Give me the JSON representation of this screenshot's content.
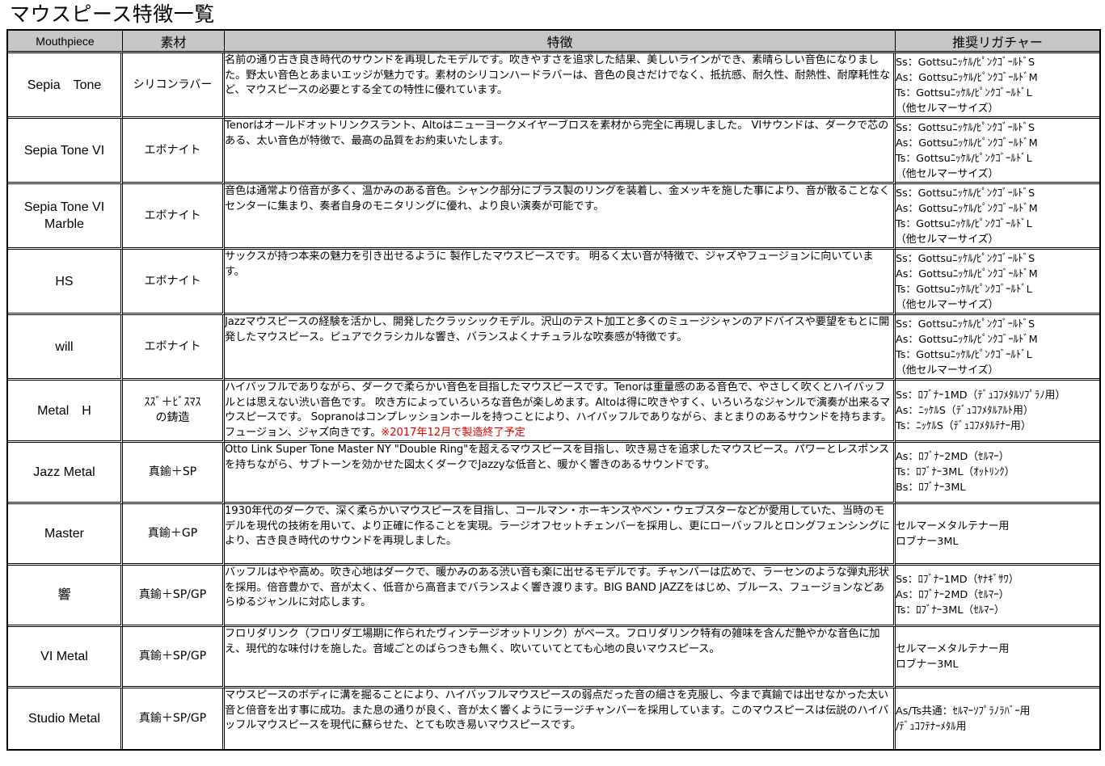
{
  "title": "マウスピース特徴一覧",
  "headers": {
    "name": "Mouthpiece",
    "material": "素材",
    "features": "特徴",
    "ligature": "推奨リガチャー"
  },
  "rows": [
    {
      "name": "Sepia　Tone",
      "material": "シリコンラバー",
      "features": "名前の通り古き良き時代のサウンドを再現したモデルです。吹きやすさを追求した結果、美しいラインができ、素晴らしい音色になりました。野太い音色とあまいエッジが魅力です。素材のシリコンハードラバーは、音色の良さだけでなく、抵抗感、耐久性、耐熱性、耐摩耗性など、マウスピースの必要とする全ての特性に優れています。",
      "ligature": [
        "Ss：Gottsuﾆｯｹﾙ/ﾋﾟﾝｸｺﾞｰﾙﾄﾞS",
        "As：Gottsuﾆｯｹﾙ/ﾋﾟﾝｸｺﾞｰﾙﾄﾞM",
        "Ts：Gottsuﾆｯｹﾙ/ﾋﾟﾝｸｺﾞｰﾙﾄﾞL",
        "（他セルマーサイズ）"
      ]
    },
    {
      "name": "Sepia Tone VI",
      "material": "エボナイト",
      "features": "Tenorはオールドオットリンクスラント、Altoはニューヨークメイヤーブロスを素材から完全に再現しました。 VIサウンドは、ダークで芯のある、太い音色が特徴で、最高の品質をお約束いたします。",
      "ligature": [
        "Ss：Gottsuﾆｯｹﾙ/ﾋﾟﾝｸｺﾞｰﾙﾄﾞS",
        "As：Gottsuﾆｯｹﾙ/ﾋﾟﾝｸｺﾞｰﾙﾄﾞM",
        "Ts：Gottsuﾆｯｹﾙ/ﾋﾟﾝｸｺﾞｰﾙﾄﾞL",
        "（他セルマーサイズ）"
      ]
    },
    {
      "name": "Sepia Tone VI\nMarble",
      "material": "エボナイト",
      "features": "音色は通常より倍音が多く、温かみのある音色。シャンク部分にブラス製のリングを装着し、金メッキを施した事により、音が散ることなくセンターに集まり、奏者自身のモニタリングに優れ、より良い演奏が可能です。",
      "ligature": [
        "Ss：Gottsuﾆｯｹﾙ/ﾋﾟﾝｸｺﾞｰﾙﾄﾞS",
        "As：Gottsuﾆｯｹﾙ/ﾋﾟﾝｸｺﾞｰﾙﾄﾞM",
        "Ts：Gottsuﾆｯｹﾙ/ﾋﾟﾝｸｺﾞｰﾙﾄﾞL",
        "（他セルマーサイズ）"
      ]
    },
    {
      "name": "HS",
      "material": "エボナイト",
      "features": "サックスが持つ本来の魅力を引き出せるように 製作したマウスピースです。 明るく太い音が特徴で、ジャズやフュージョンに向いています。",
      "ligature": [
        "Ss：Gottsuﾆｯｹﾙ/ﾋﾟﾝｸｺﾞｰﾙﾄﾞS",
        "As：Gottsuﾆｯｹﾙ/ﾋﾟﾝｸｺﾞｰﾙﾄﾞM",
        "Ts：Gottsuﾆｯｹﾙ/ﾋﾟﾝｸｺﾞｰﾙﾄﾞL",
        "（他セルマーサイズ）"
      ]
    },
    {
      "name": "will",
      "material": "エボナイト",
      "features": "Jazzマウスピースの経験を活かし、開発したクラッシックモデル。沢山のテスト加工と多くのミュージシャンのアドバイスや要望をもとに開発したマウスピース。ピュアでクラシカルな響き、バランスよくナチュラルな吹奏感が特徴です。",
      "ligature": [
        "Ss：Gottsuﾆｯｹﾙ/ﾋﾟﾝｸｺﾞｰﾙﾄﾞS",
        "As：Gottsuﾆｯｹﾙ/ﾋﾟﾝｸｺﾞｰﾙﾄﾞM",
        "Ts：Gottsuﾆｯｹﾙ/ﾋﾟﾝｸｺﾞｰﾙﾄﾞL",
        "（他セルマーサイズ）"
      ]
    },
    {
      "name": "Metal　H",
      "material": "ｽｽﾞ＋ﾋﾞｽﾏｽ\nの鋳造",
      "features": "ハイバッフルでありながら、ダークで柔らかい音色を目指したマウスピースです。Tenorは重量感のある音色で、やさしく吹くとハイバッフルとは思えない渋い音色です。 吹き方によっていろいろな音色が楽しめます。Altoは得に吹きやすく、いろいろなジャンルで演奏が出来るマウスピースです。 Sopranoはコンプレッションホールを持つことにより、ハイバッフルでありながら、まとまりのあるサウンドを持ちます。 フュージョン、ジャズ向きです。",
      "features_note": "※2017年12月で製造終了予定",
      "ligature": [
        "Ss：ﾛﾌﾞﾅｰ1MD（ﾃﾞｭｺﾌﾒﾀﾙｿﾌﾟﾗﾉ用）",
        "As：ﾆｯｹﾙS（ﾃﾞｭｺﾌﾒﾀﾙｱﾙﾄ用）",
        "Ts：ﾆｯｹﾙS（ﾃﾞｭｺﾌﾒﾀﾙﾃﾅｰ用）"
      ]
    },
    {
      "name": "Jazz Metal",
      "material": "真鍮＋SP",
      "features": "Otto Link Super Tone Master NY \"Double Ring\"を超えるマウスピースを目指し、吹き易さを追求したマウスピース。パワーとレスポンスを持ちながら、サブトーンを効かせた図太くダークでJazzyな低音と、暖かく響きのあるサウンドです。",
      "ligature": [
        "As：ﾛﾌﾞﾅｰ2MD（ｾﾙﾏｰ）",
        "Ts：ﾛﾌﾞﾅｰ3ML（ｵｯﾄﾘﾝｸ）",
        "Bs：ﾛﾌﾞﾅｰ3ML"
      ]
    },
    {
      "name": "Master",
      "material": "真鍮＋GP",
      "features": "1930年代のダークで、深く柔らかいマウスピースを目指し、コールマン・ホーキンスやベン・ウェブスターなどが愛用していた、当時のモデルを現代の技術を用いて、より正確に作ることを実現。ラージオフセットチェンバーを採用し、更にローバッフルとロングフェンシングにより、古き良き時代のサウンドを再現しました。",
      "ligature": [
        "セルマーメタルテナー用",
        "ロブナー3ML"
      ]
    },
    {
      "name": "響",
      "material": "真鍮＋SP/GP",
      "features": "バッフルはやや高め。吹き心地はダークで、暖かみのある渋い音も楽に出せるモデルです。チャンバーは広めで、ラーセンのような弾丸形状を採用。倍音豊かで、音が太く、低音から高音までバランスよく響き渡ります。BIG BAND JAZZをはじめ、ブルース、フュージョンなどあらゆるジャンルに対応します。",
      "ligature": [
        "Ss：ﾛﾌﾞﾅｰ1MD（ﾔﾅｷﾞｻﾜ）",
        "As：ﾛﾌﾞﾅｰ2MD（ｾﾙﾏｰ）",
        "Ts：ﾛﾌﾞﾅｰ3ML（ｾﾙﾏｰ）"
      ]
    },
    {
      "name": "VI Metal",
      "material": "真鍮＋SP/GP",
      "features": "フロリダリンク（フロリダ工場期に作られたヴィンテージオットリンク）がベース。フロリダリンク特有の雑味を含んだ艶やかな音色に加え、現代的な味付けを施した。音域ごとのばらつきも無く、吹いていてとても心地の良いマウスピース。",
      "ligature": [
        "セルマーメタルテナー用",
        "ロブナー3ML"
      ]
    },
    {
      "name": "Studio Metal",
      "material": "真鍮＋SP/GP",
      "features": "マウスピースのボディに溝を掘ることにより、ハイバッフルマウスピースの弱点だった音の細さを克服し、今まで真鍮では出せなかった太い音と倍音を出す事に成功。また息の通りが良く、音が太く響くようにラージチャンバーを採用しています。このマウスピースは伝説のハイバッフルマウスピースを現代に蘇らせた、とても吹き易いマウスピースです。",
      "ligature": [
        "As/Ts共通：ｾﾙﾏｰｿﾌﾟﾗﾉﾗﾊﾞｰ用",
        "/ﾃﾞｭｺﾌﾃﾅｰﾒﾀﾙ用"
      ]
    }
  ],
  "colors": {
    "header_bg": "#c6c6c6",
    "note": "#e00000"
  }
}
